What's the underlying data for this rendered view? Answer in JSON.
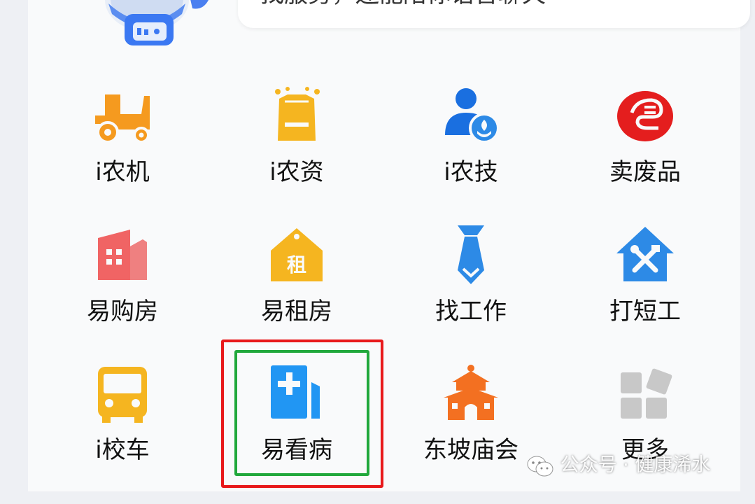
{
  "assistant": {
    "prompt_text": "找服务，还能陪你语音聊天"
  },
  "services": [
    {
      "label": "i农机",
      "icon": "tractor-icon",
      "color": "#f59a1f"
    },
    {
      "label": "i农资",
      "icon": "supplies-bag-icon",
      "color": "#f5b520"
    },
    {
      "label": "i农技",
      "icon": "agri-expert-icon",
      "color": "#1a6fe0"
    },
    {
      "label": "卖废品",
      "icon": "recycle-logo-icon",
      "color": "#e41e1e"
    },
    {
      "label": "易购房",
      "icon": "building-icon",
      "color": "#f06464"
    },
    {
      "label": "易租房",
      "icon": "rent-house-icon",
      "color": "#f5b520"
    },
    {
      "label": "找工作",
      "icon": "necktie-icon",
      "color": "#2d8ae6"
    },
    {
      "label": "打短工",
      "icon": "tools-house-icon",
      "color": "#2d8ae6"
    },
    {
      "label": "i校车",
      "icon": "school-bus-icon",
      "color": "#f5b520"
    },
    {
      "label": "易看病",
      "icon": "medical-icon",
      "color": "#2196f3"
    },
    {
      "label": "东坡庙会",
      "icon": "temple-icon",
      "color": "#f37021"
    },
    {
      "label": "更多",
      "icon": "more-grid-icon",
      "color": "#c8c8c8"
    }
  ],
  "rent_icon_char": "租",
  "watermark": {
    "text": "公众号 · 健康浠水",
    "icon": "wechat-icon"
  },
  "highlight_colors": {
    "outer": "#e8191b",
    "inner": "#21a83c"
  }
}
